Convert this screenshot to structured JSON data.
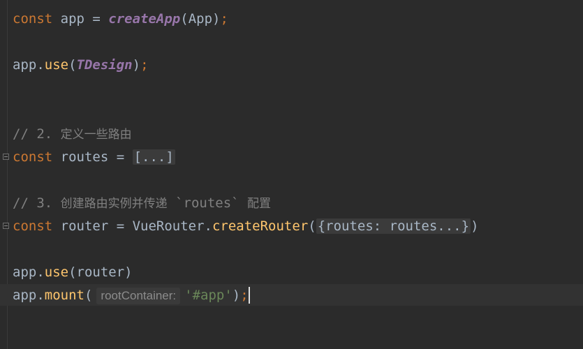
{
  "editor": {
    "line1": {
      "kw": "const",
      "name": " app = ",
      "fn": "createApp",
      "open": "(",
      "arg": "App",
      "close": ")",
      "semi": ";"
    },
    "line2": {
      "obj": "app.",
      "fn": "use",
      "open": "(",
      "arg": "TDesign",
      "close": ")",
      "semi": ";"
    },
    "line3": {
      "prefix": "// 2. ",
      "text": "定义一些路由"
    },
    "line4": {
      "kw": "const",
      "name": " routes = ",
      "folded": "[...]"
    },
    "line5": {
      "prefix": "// 3. ",
      "text": "创建路由实例并传递",
      "code": " `routes` ",
      "text2": "配置"
    },
    "line6": {
      "kw": "const",
      "name": " router = VueRouter.",
      "fn": "createRouter",
      "open": "(",
      "folded": "{routes: routes...}",
      "close": ")"
    },
    "line7": {
      "obj": "app.",
      "fn": "use",
      "args": "(router)"
    },
    "line8": {
      "obj": "app.",
      "fn": "mount",
      "open": "(",
      "hint": "rootContainer:",
      "str": "'#app'",
      "close": ")",
      "semi": ";"
    }
  }
}
